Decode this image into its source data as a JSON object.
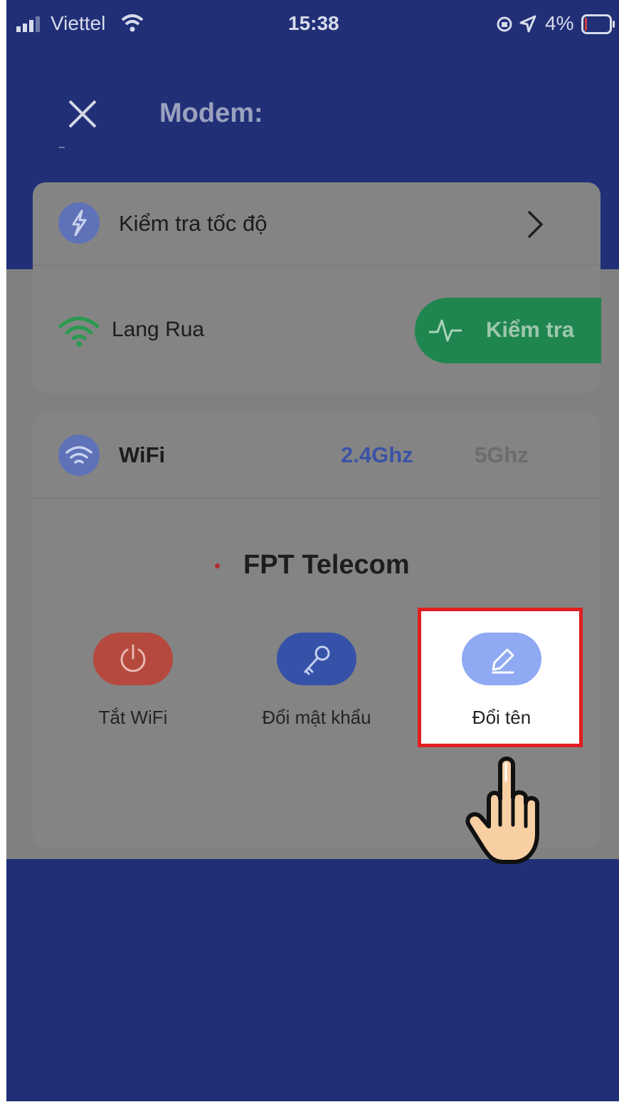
{
  "status_bar": {
    "carrier": "Viettel",
    "time": "15:38",
    "battery": "4%"
  },
  "header": {
    "title": "Modem:"
  },
  "speed_test": {
    "label": "Kiểm tra tốc độ",
    "network_name": "Lang Rua",
    "check_button": "Kiểm tra"
  },
  "wifi": {
    "label": "WiFi",
    "tabs": [
      {
        "label": "2.4Ghz",
        "active": true
      },
      {
        "label": "5Ghz",
        "active": false
      }
    ],
    "ssid": "FPT Telecom",
    "actions": [
      {
        "label": "Tắt WiFi",
        "icon": "power-icon",
        "color": "#b5493e"
      },
      {
        "label": "Đổi mật khẩu",
        "icon": "key-icon",
        "color": "#3552a8"
      },
      {
        "label": "Đổi tên",
        "icon": "pencil-icon",
        "color": "#8fa9f3"
      }
    ]
  },
  "colors": {
    "header_blue": "#212f77",
    "accent_green": "#20864f",
    "highlight_red": "#e01f1f",
    "tab_active": "#3b52a6"
  }
}
